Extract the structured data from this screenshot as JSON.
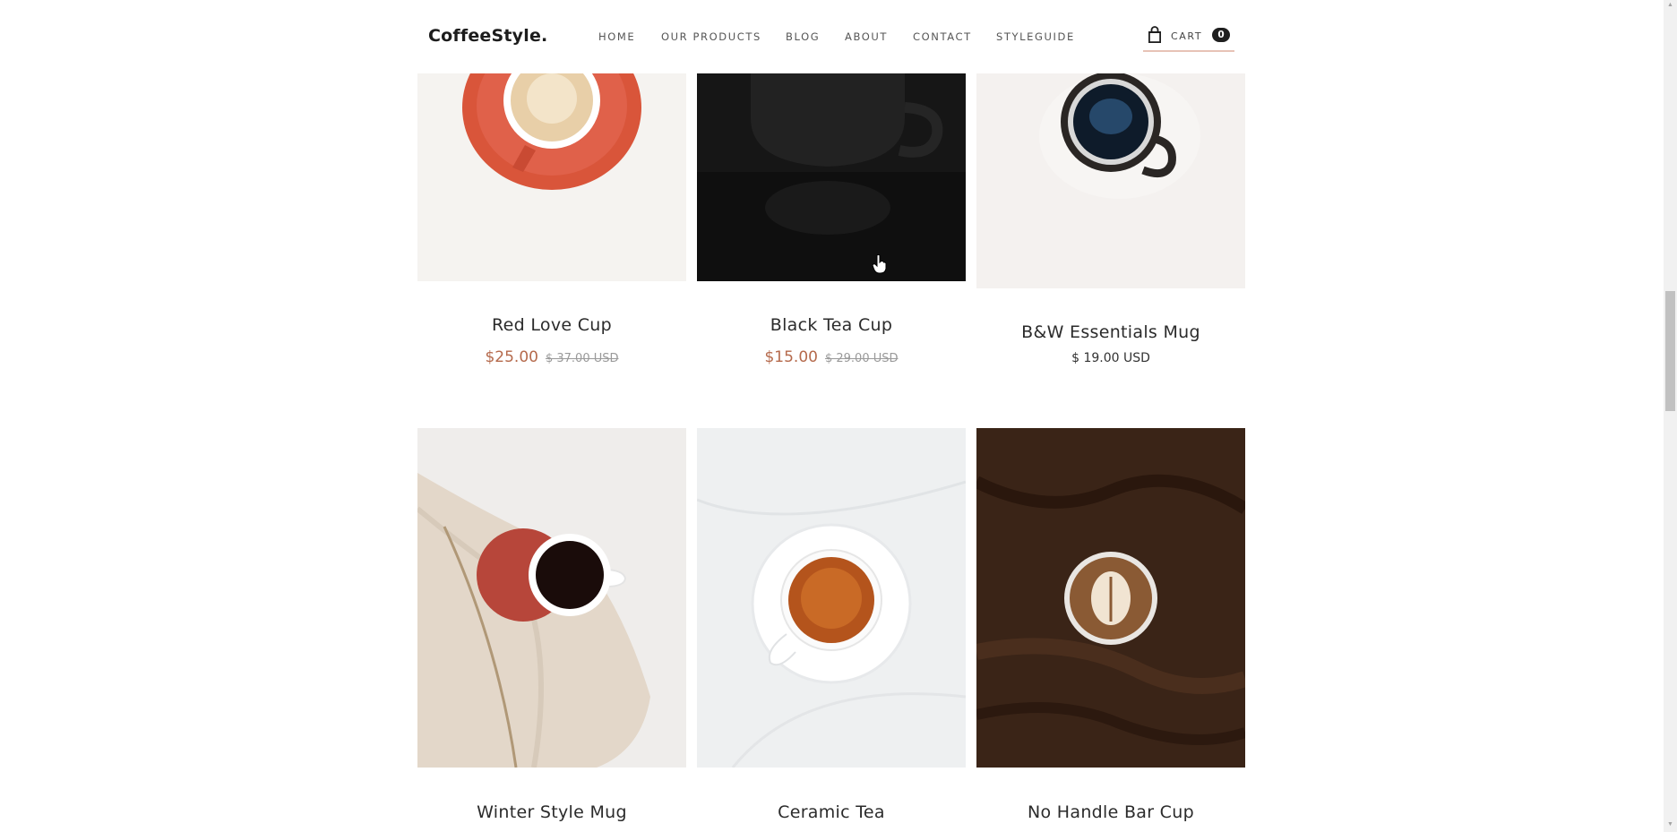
{
  "brand": "CoffeeStyle.",
  "nav": {
    "items": [
      "HOME",
      "OUR PRODUCTS",
      "BLOG",
      "ABOUT",
      "CONTACT",
      "STYLEGUIDE"
    ]
  },
  "cart": {
    "label": "CART",
    "count": "0",
    "icon": "shopping-bag-icon"
  },
  "products": [
    {
      "name": "Red Love Cup",
      "price": "$25.00",
      "old_price": "$ 37.00 USD"
    },
    {
      "name": "Black Tea Cup",
      "price": "$15.00",
      "old_price": "$ 29.00 USD"
    },
    {
      "name": "B&W Essentials Mug",
      "price": "$ 19.00 USD"
    },
    {
      "name": "Winter Style Mug"
    },
    {
      "name": "Ceramic Tea"
    },
    {
      "name": "No Handle Bar Cup"
    }
  ],
  "colors": {
    "sale_price": "#b56a4c",
    "cart_underline": "#e7c3b6",
    "text": "#1f1f1f"
  }
}
